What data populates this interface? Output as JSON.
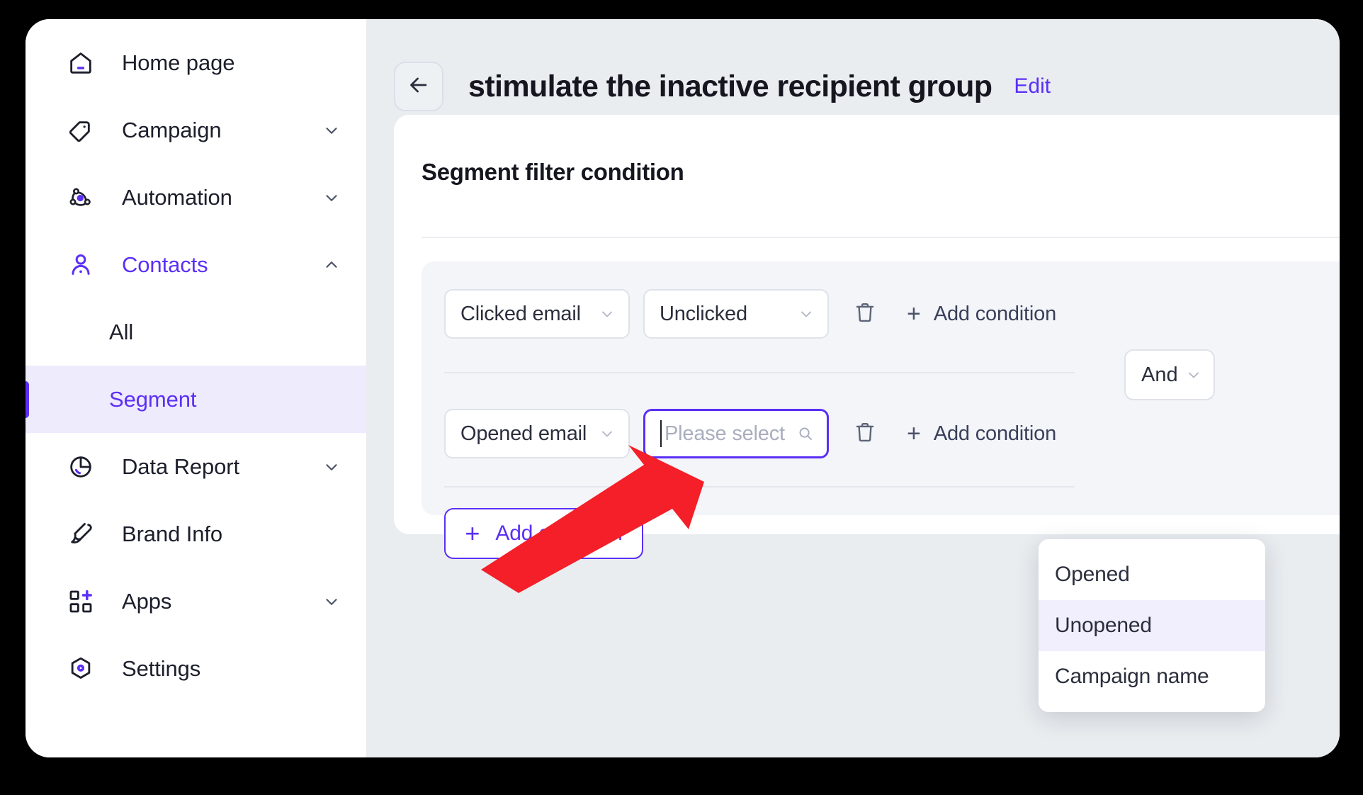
{
  "sidebar": {
    "items": [
      {
        "label": "Home page",
        "icon": "home-icon",
        "expandable": false,
        "active": false
      },
      {
        "label": "Campaign",
        "icon": "tag-icon",
        "expandable": true,
        "active": false
      },
      {
        "label": "Automation",
        "icon": "automation-icon",
        "expandable": true,
        "active": false
      },
      {
        "label": "Contacts",
        "icon": "user-icon",
        "expandable": true,
        "active": true
      },
      {
        "label": "Data Report",
        "icon": "pie-chart-icon",
        "expandable": true,
        "active": false
      },
      {
        "label": "Brand Info",
        "icon": "brush-icon",
        "expandable": false,
        "active": false
      },
      {
        "label": "Apps",
        "icon": "apps-add-icon",
        "expandable": true,
        "active": false
      },
      {
        "label": "Settings",
        "icon": "hexagon-gear-icon",
        "expandable": false,
        "active": false
      }
    ],
    "contacts_children": [
      {
        "label": "All",
        "selected": false
      },
      {
        "label": "Segment",
        "selected": true
      }
    ]
  },
  "header": {
    "back_label": "Back",
    "title": "stimulate the inactive recipient group",
    "edit_label": "Edit"
  },
  "card": {
    "title": "Segment filter condition"
  },
  "conditions": [
    {
      "field": "Clicked email",
      "value": "Unclicked",
      "value_is_placeholder": false,
      "delete_label": "Delete",
      "add_label": "Add condition"
    },
    {
      "field": "Opened email",
      "value": "Please select",
      "value_is_placeholder": true,
      "delete_label": "Delete",
      "add_label": "Add condition"
    }
  ],
  "logic_operator": "And",
  "add_condition_button": "+  Add condition",
  "add_condition_button_label": "Add condition",
  "dropdown": {
    "options": [
      {
        "label": "Opened",
        "highlighted": false
      },
      {
        "label": "Unopened",
        "highlighted": true
      },
      {
        "label": "Campaign name",
        "highlighted": false
      }
    ]
  },
  "colors": {
    "accent": "#5b2ff5",
    "accent_soft": "#eeebfd",
    "page_bg": "#e9edf0",
    "card_bg": "#ffffff",
    "group_bg": "#f4f5f9",
    "text": "#1c1e2b",
    "muted_text": "#a9aebd",
    "annotation_arrow": "#f41f28"
  }
}
